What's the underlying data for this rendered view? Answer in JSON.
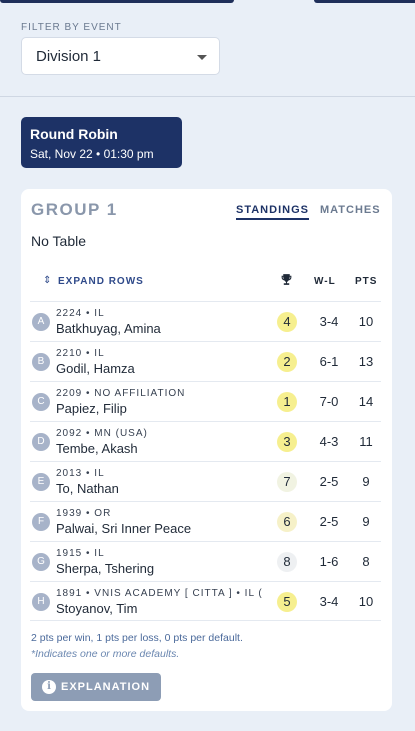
{
  "filter": {
    "label": "FILTER BY EVENT",
    "value": "Division 1"
  },
  "round": {
    "title": "Round Robin",
    "subtitle": "Sat, Nov 22 • 01:30 pm"
  },
  "group": {
    "title": "GROUP 1",
    "tabs": {
      "standings": "STANDINGS",
      "matches": "MATCHES"
    },
    "no_table": "No Table",
    "expand_rows": "EXPAND ROWS",
    "expand_icon": "⇕",
    "columns": {
      "trophy_icon": "trophy-icon",
      "wl": "W-L",
      "pts": "PTS"
    },
    "rows": [
      {
        "initial": "A",
        "meta": "2224 • IL",
        "name": "Batkhuyag, Amina",
        "rank": "4",
        "rank_color": "#f6ef8f",
        "wl": "3-4",
        "pts": "10"
      },
      {
        "initial": "B",
        "meta": "2210 • IL",
        "name": "Godil, Hamza",
        "rank": "2",
        "rank_color": "#f6ef8f",
        "wl": "6-1",
        "pts": "13"
      },
      {
        "initial": "C",
        "meta": "2209 • NO AFFILIATION",
        "name": "Papiez, Filip",
        "rank": "1",
        "rank_color": "#f6ef8f",
        "wl": "7-0",
        "pts": "14"
      },
      {
        "initial": "D",
        "meta": "2092 • MN (USA)",
        "name": "Tembe, Akash",
        "rank": "3",
        "rank_color": "#f6ef8f",
        "wl": "4-3",
        "pts": "11"
      },
      {
        "initial": "E",
        "meta": "2013 • IL",
        "name": "To, Nathan",
        "rank": "7",
        "rank_color": "#f1f3e2",
        "wl": "2-5",
        "pts": "9"
      },
      {
        "initial": "F",
        "meta": "1939 • OR",
        "name": "Palwai, Sri Inner Peace",
        "rank": "6",
        "rank_color": "#f6f1c8",
        "wl": "2-5",
        "pts": "9"
      },
      {
        "initial": "G",
        "meta": "1915 • IL",
        "name": "Sherpa, Tshering",
        "rank": "8",
        "rank_color": "#eef0f2",
        "wl": "1-6",
        "pts": "8"
      },
      {
        "initial": "H",
        "meta": "1891 • VNIS ACADEMY [ CITTA ] • IL (",
        "name": "Stoyanov, Tim",
        "rank": "5",
        "rank_color": "#f6ef8f",
        "wl": "3-4",
        "pts": "10"
      }
    ],
    "footnote_points": "2 pts per win, 1 pts per loss, 0 pts per default.",
    "footnote_defaults": "*Indicates one or more defaults.",
    "explanation_button": "EXPLANATION"
  },
  "colors": {
    "primary": "#1d3266",
    "background": "#e9eff7"
  }
}
